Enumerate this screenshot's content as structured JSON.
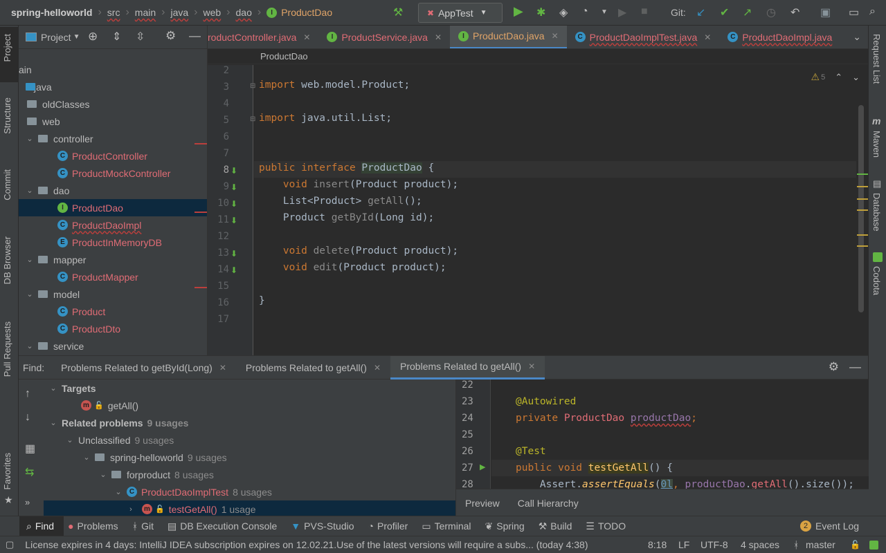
{
  "breadcrumb": {
    "project": "spring-helloworld",
    "items": [
      "src",
      "main",
      "java",
      "web",
      "dao"
    ],
    "file": "ProductDao"
  },
  "toolbar": {
    "run_config": "AppTest",
    "git_label": "Git:"
  },
  "left_strip": [
    "Project",
    "Structure",
    "Commit",
    "DB Browser",
    "Pull Requests",
    "Favorites"
  ],
  "right_strip": [
    "Request List",
    "Maven",
    "Database",
    "Codota"
  ],
  "project_panel": {
    "title": "Project",
    "tree": [
      {
        "label": "ain"
      },
      {
        "label": "java"
      },
      {
        "label": "oldClasses"
      },
      {
        "label": "web"
      },
      {
        "label": "controller"
      },
      {
        "label": "ProductController"
      },
      {
        "label": "ProductMockController"
      },
      {
        "label": "dao"
      },
      {
        "label": "ProductDao"
      },
      {
        "label": "ProductDaoImpl"
      },
      {
        "label": "ProductInMemoryDB"
      },
      {
        "label": "mapper"
      },
      {
        "label": "ProductMapper"
      },
      {
        "label": "model"
      },
      {
        "label": "Product"
      },
      {
        "label": "ProductDto"
      },
      {
        "label": "service"
      }
    ]
  },
  "editor": {
    "tabs": [
      {
        "label": "roductController.java"
      },
      {
        "label": "ProductService.java"
      },
      {
        "label": "ProductDao.java"
      },
      {
        "label": "ProductDaoImplTest.java"
      },
      {
        "label": "ProductDaoImpl.java"
      }
    ],
    "breadcrumb": "ProductDao",
    "warnings": "5",
    "line_numbers": [
      "2",
      "3",
      "4",
      "5",
      "6",
      "7",
      "8",
      "9",
      "10",
      "11",
      "12",
      "13",
      "14",
      "15",
      "16",
      "17"
    ],
    "lines": {
      "l3a": "import",
      "l3b": " web.model.Product;",
      "l5a": "import",
      "l5b": " java.util.List;",
      "l8a": "public interface ",
      "l8b": "ProductDao",
      "l8c": " {",
      "l9a": "    void ",
      "l9b": "insert",
      "l9c": "(Product product);",
      "l10a": "    List<Product> ",
      "l10b": "getAll",
      "l10c": "();",
      "l11a": "    Product ",
      "l11b": "getById",
      "l11c": "(Long id);",
      "l13a": "    void ",
      "l13b": "delete",
      "l13c": "(Product product);",
      "l14a": "    void ",
      "l14b": "edit",
      "l14c": "(Product product);",
      "l16": "}"
    }
  },
  "find": {
    "label": "Find:",
    "tabs": [
      {
        "label": "Problems Related to getById(Long)"
      },
      {
        "label": "Problems Related to getAll()"
      },
      {
        "label": "Problems Related to getAll()"
      }
    ],
    "tree": {
      "targets": "Targets",
      "getall": "getAll()",
      "related": "Related problems",
      "related_count": "9 usages",
      "unclassified": "Unclassified",
      "unclassified_count": "9 usages",
      "project": "spring-helloworld",
      "project_count": "9 usages",
      "package": "forproduct",
      "package_count": "8 usages",
      "cls": "ProductDaoImplTest",
      "cls_count": "8 usages",
      "method": "testGetAll()",
      "method_count": "1 usage"
    },
    "preview": {
      "line_numbers": [
        "22",
        "23",
        "24",
        "25",
        "26",
        "27",
        "28"
      ],
      "l23": "@Autowired",
      "l24a": "private ",
      "l24b": "ProductDao",
      "l24c": " ",
      "l24d": "productDao",
      "l24e": ";",
      "l26": "@Test",
      "l27a": "public void ",
      "l27b": "testGetAll",
      "l27c": "() {",
      "l28a": "    Assert.",
      "l28b": "assertEquals",
      "l28c": "(",
      "l28d": "0l",
      "l28e": ", ",
      "l28f": "productDao",
      "l28g": ".",
      "l28h": "getAll",
      "l28i": "().size());",
      "tabs": [
        "Preview",
        "Call Hierarchy"
      ]
    }
  },
  "bottom_tools": [
    {
      "label": "Find"
    },
    {
      "label": "Problems"
    },
    {
      "label": "Git"
    },
    {
      "label": "DB Execution Console"
    },
    {
      "label": "PVS-Studio"
    },
    {
      "label": "Profiler"
    },
    {
      "label": "Terminal"
    },
    {
      "label": "Spring"
    },
    {
      "label": "Build"
    },
    {
      "label": "TODO"
    }
  ],
  "event_log": {
    "count": "2",
    "label": "Event Log"
  },
  "status": {
    "message": "License expires in 4 days: IntelliJ IDEA subscription expires on 12.02.21.Use of the latest versions will require a subs... (today 4:38)",
    "position": "8:18",
    "line_sep": "LF",
    "encoding": "UTF-8",
    "indent": "4 spaces",
    "branch": "master"
  },
  "colors": {
    "accent": "#4a88c7",
    "keyword": "#cc7832",
    "error": "#e06c75"
  }
}
